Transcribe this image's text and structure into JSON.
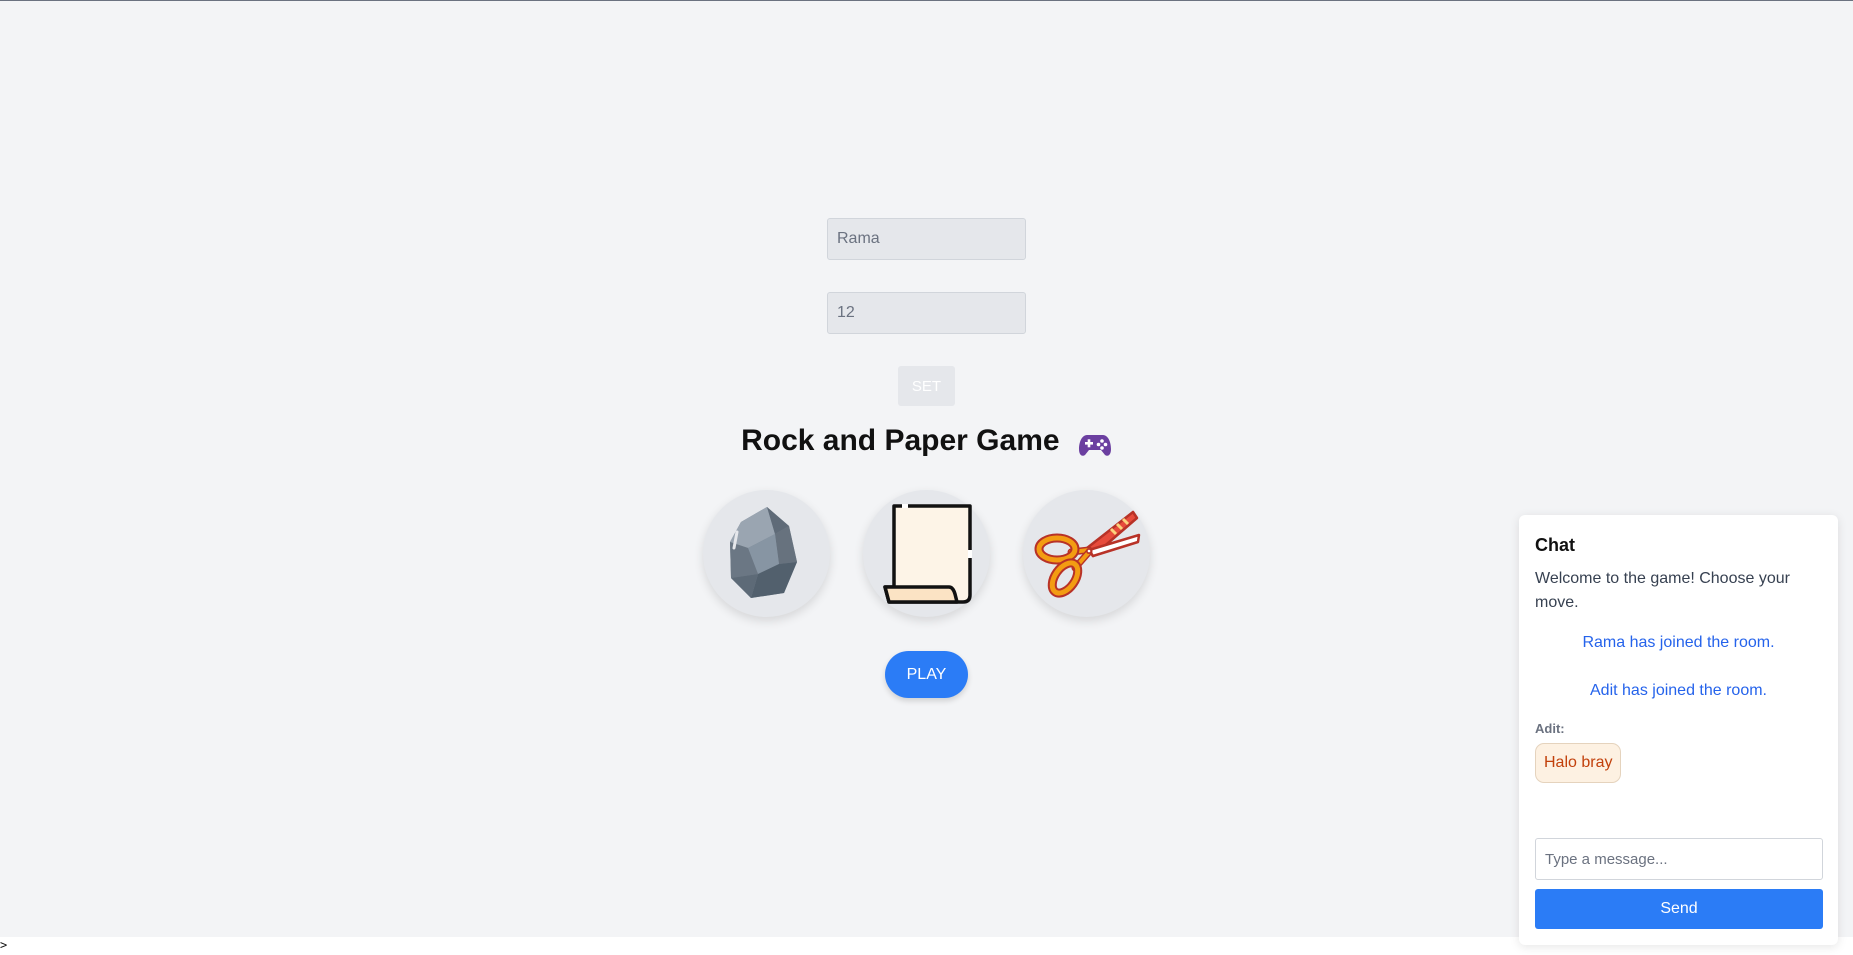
{
  "form": {
    "name_value": "Rama",
    "room_value": "12",
    "set_label": "SET"
  },
  "game": {
    "title": "Rock and Paper Game",
    "title_icon": "game-controller-icon",
    "choices": [
      {
        "id": "rock",
        "icon": "rock-icon"
      },
      {
        "id": "paper",
        "icon": "paper-icon"
      },
      {
        "id": "scissors",
        "icon": "scissors-icon"
      }
    ],
    "play_label": "PLAY"
  },
  "chat": {
    "title": "Chat",
    "welcome": "Welcome to the game! Choose your move.",
    "system_messages": [
      "Rama has joined the room.",
      "Adit has joined the room."
    ],
    "messages": [
      {
        "sender": "Adit:",
        "text": "Halo bray"
      }
    ],
    "input_placeholder": "Type a message...",
    "send_label": "Send"
  },
  "footer": {
    "prompt": ">"
  },
  "colors": {
    "background": "#f3f4f6",
    "primary": "#2b7cf6",
    "system_text": "#2563eb",
    "bubble_bg": "#fdf1e2",
    "bubble_text": "#c2410c"
  }
}
